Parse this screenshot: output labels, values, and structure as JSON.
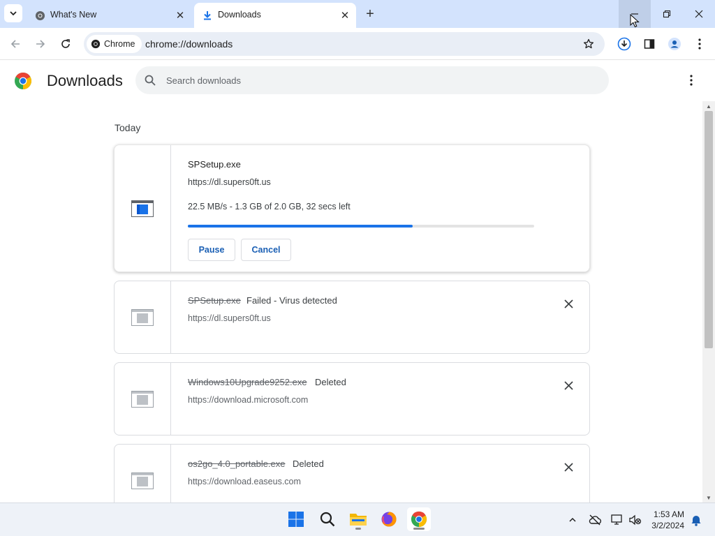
{
  "tabs": [
    {
      "label": "What's New",
      "icon": "chrome-icon",
      "active": false
    },
    {
      "label": "Downloads",
      "icon": "download-icon",
      "active": true
    }
  ],
  "toolbar": {
    "site_chip": "Chrome",
    "url": "chrome://downloads"
  },
  "page": {
    "title": "Downloads",
    "search_placeholder": "Search downloads"
  },
  "section": {
    "label": "Today"
  },
  "downloads": [
    {
      "filename": "SPSetup.exe",
      "source": "https://dl.supers0ft.us",
      "progress_text": "22.5 MB/s - 1.3 GB of 2.0 GB, 32 secs left",
      "progress": 0.65,
      "buttons": {
        "pause": "Pause",
        "cancel": "Cancel"
      }
    },
    {
      "filename": "SPSetup.exe",
      "status": "Failed - Virus detected",
      "source": "https://dl.supers0ft.us"
    },
    {
      "filename": "Windows10Upgrade9252.exe",
      "status": "Deleted",
      "source": "https://download.microsoft.com"
    },
    {
      "filename": "os2go_4.0_portable.exe",
      "status": "Deleted",
      "source": "https://download.easeus.com"
    }
  ],
  "taskbar": {
    "time": "1:53 AM",
    "date": "3/2/2024"
  },
  "colors": {
    "accent": "#1a73e8",
    "tabstrip": "#d3e3fd",
    "button_text": "#1a5fb4"
  }
}
